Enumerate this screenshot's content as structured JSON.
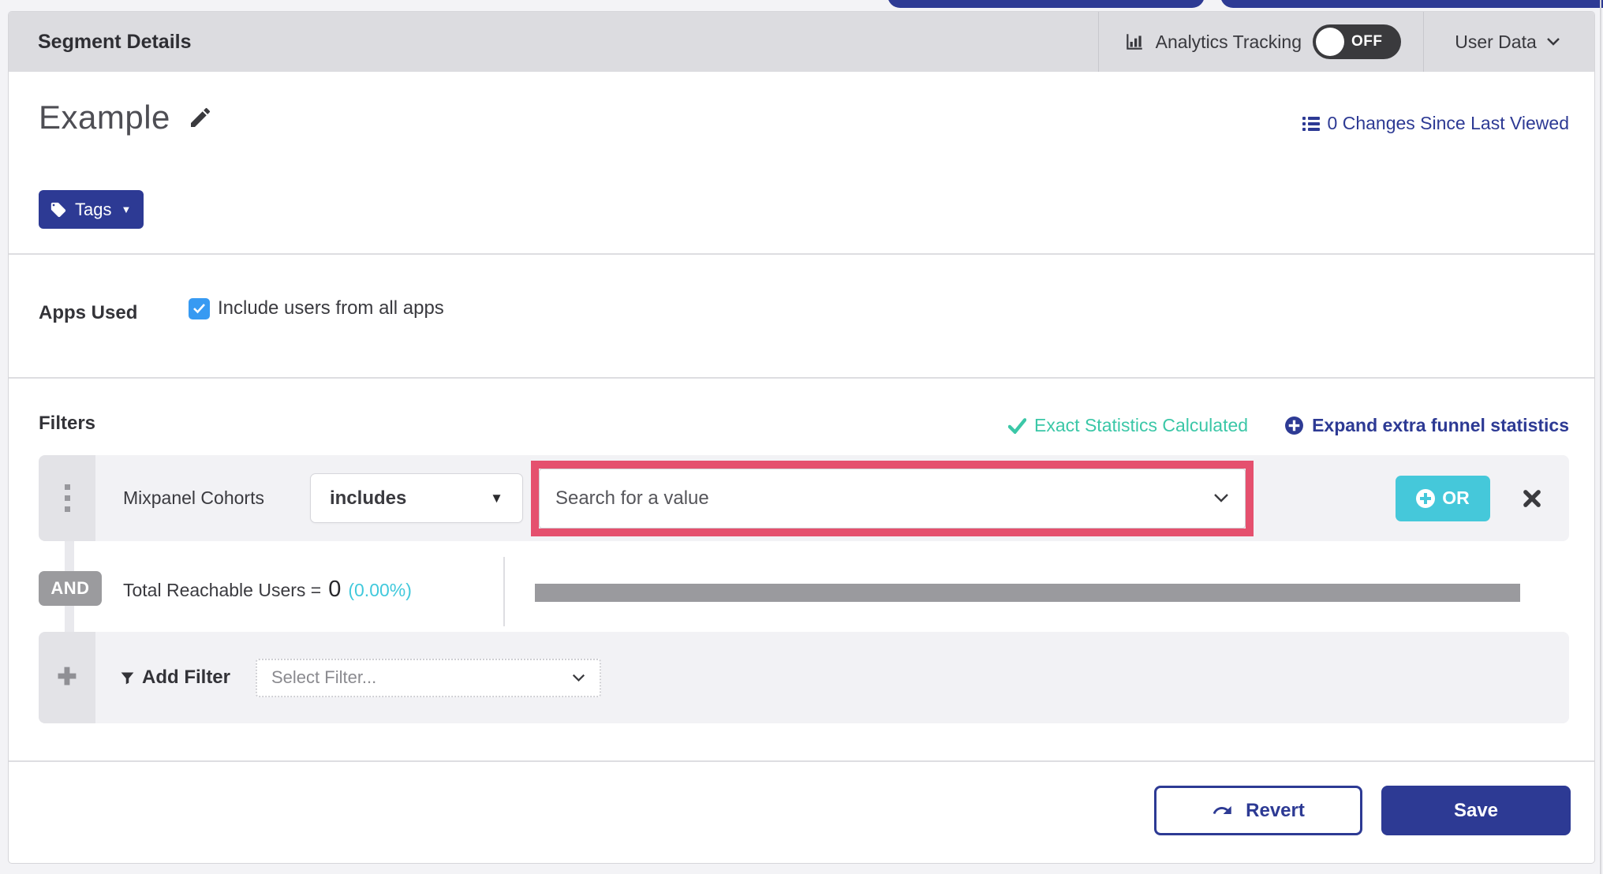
{
  "header": {
    "title": "Segment Details",
    "analytics_label": "Analytics Tracking",
    "analytics_toggle_state": "OFF",
    "user_data_label": "User Data"
  },
  "segment": {
    "name": "Example",
    "tags_button_label": "Tags",
    "changes_link": "0 Changes Since Last Viewed"
  },
  "apps_used": {
    "label": "Apps Used",
    "checkbox_label": "Include users from all apps",
    "checkbox_checked": true
  },
  "filters": {
    "title": "Filters",
    "exact_stats_label": "Exact Statistics Calculated",
    "expand_stats_label": "Expand extra funnel statistics",
    "rows": [
      {
        "name": "Mixpanel Cohorts",
        "operator": "includes",
        "value_placeholder": "Search for a value",
        "or_button_label": "OR"
      }
    ],
    "and_badge": "AND",
    "total_reachable_label": "Total Reachable Users =",
    "total_reachable_value": "0",
    "total_reachable_percent": "(0.00%)",
    "add_filter_label": "Add Filter",
    "select_filter_placeholder": "Select Filter..."
  },
  "footer": {
    "revert_label": "Revert",
    "save_label": "Save"
  },
  "colors": {
    "navy": "#2d3a94",
    "teal_green": "#3bc7a7",
    "cyan": "#41c9dc",
    "highlight_pink": "#e5506e",
    "checkbox_blue": "#379af2",
    "header_gray": "#dcdce0"
  }
}
